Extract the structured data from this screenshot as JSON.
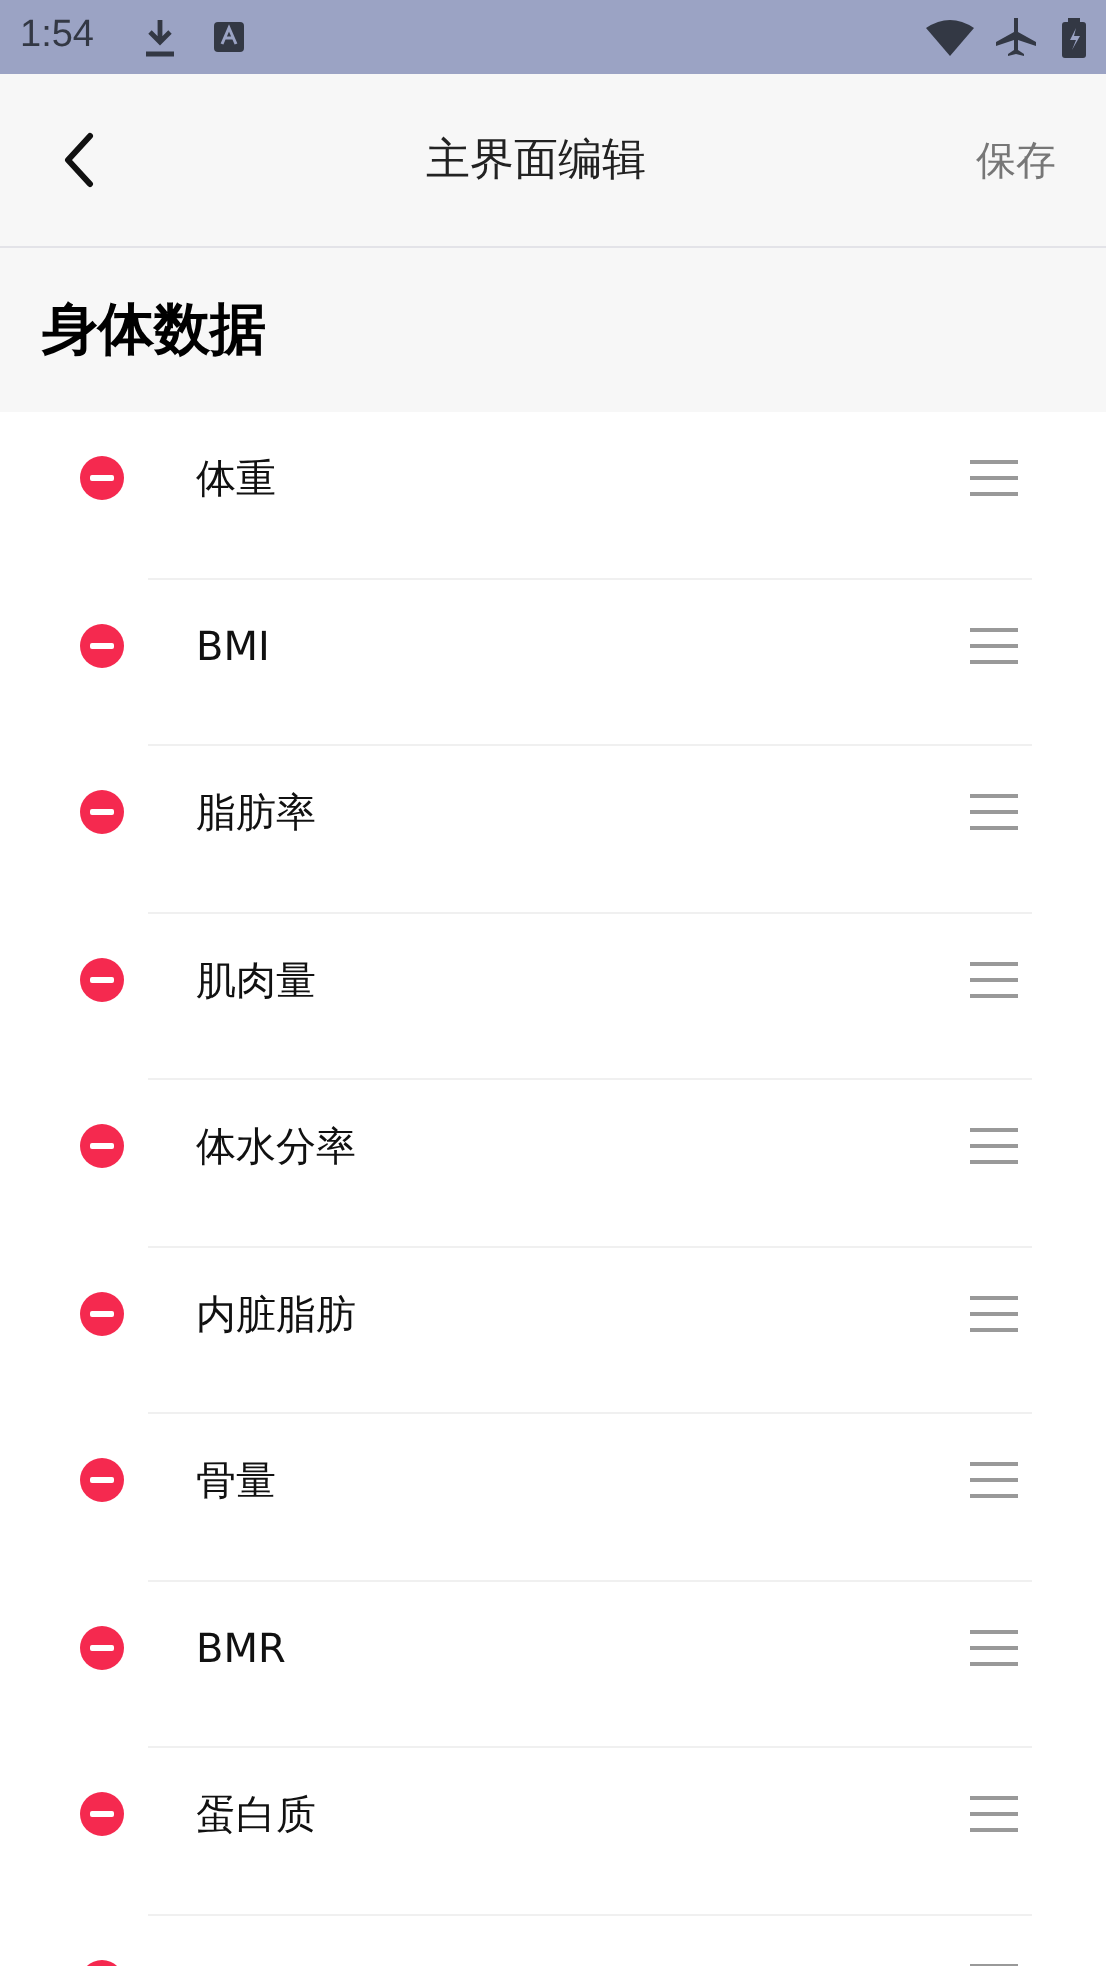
{
  "status_bar": {
    "time": "1:54"
  },
  "header": {
    "title": "主界面编辑",
    "action": "保存"
  },
  "section": {
    "title": "身体数据"
  },
  "items": [
    {
      "label": "体重"
    },
    {
      "label": "BMI"
    },
    {
      "label": "脂肪率"
    },
    {
      "label": "肌肉量"
    },
    {
      "label": "体水分率"
    },
    {
      "label": "内脏脂肪"
    },
    {
      "label": "骨量"
    },
    {
      "label": "BMR"
    },
    {
      "label": "蛋白质"
    },
    {
      "cut_off": true
    }
  ]
}
